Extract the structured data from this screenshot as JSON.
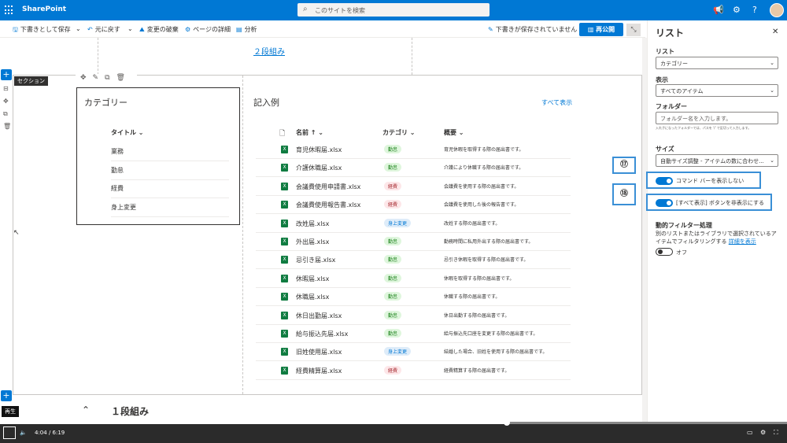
{
  "topbar": {
    "brand": "SharePoint",
    "search_placeholder": "このサイトを検索"
  },
  "cmdbar": {
    "save_draft": "下書きとして保存",
    "undo": "元に戻す",
    "discard": "変更の破棄",
    "page_details": "ページの詳細",
    "analytics": "分析",
    "draft_status": "下書きが保存されていません",
    "publish": "再公開"
  },
  "canvas": {
    "twocol_link": "２段組み",
    "section_tag": "セクション",
    "bottom_title": "１段組み"
  },
  "category_part": {
    "title": "カテゴリー",
    "column": "タイトル",
    "items": [
      "業務",
      "勤怠",
      "経費",
      "身上変更"
    ]
  },
  "example_part": {
    "title": "記入例",
    "see_all": "すべて表示",
    "headers": {
      "name": "名前",
      "category": "カテゴリ",
      "summary": "概要"
    },
    "rows": [
      {
        "name": "育児休暇届.xlsx",
        "cat": "勤怠",
        "color": "green",
        "desc": "育児休暇を取得する際の届出書です。"
      },
      {
        "name": "介護休職届.xlsx",
        "cat": "勤怠",
        "color": "green",
        "desc": "介護により休職する際の届出書です。"
      },
      {
        "name": "会議費使用申請書.xlsx",
        "cat": "経費",
        "color": "red",
        "desc": "会議費を使用する際の届出書です。"
      },
      {
        "name": "会議費使用報告書.xlsx",
        "cat": "経費",
        "color": "red",
        "desc": "会議費を使用した後の報告書です。"
      },
      {
        "name": "改姓届.xlsx",
        "cat": "身上変更",
        "color": "blue",
        "desc": "改姓する際の届出書です。"
      },
      {
        "name": "外出届.xlsx",
        "cat": "勤怠",
        "color": "green",
        "desc": "勤務時間に私用外出する際の届出書です。"
      },
      {
        "name": "忌引き届.xlsx",
        "cat": "勤怠",
        "color": "green",
        "desc": "忌引き休暇を取得する際の届出書です。"
      },
      {
        "name": "休暇届.xlsx",
        "cat": "勤怠",
        "color": "green",
        "desc": "休暇を取得する際の届出書です。"
      },
      {
        "name": "休職届.xlsx",
        "cat": "勤怠",
        "color": "green",
        "desc": "休職する際の届出書です。"
      },
      {
        "name": "休日出勤届.xlsx",
        "cat": "勤怠",
        "color": "green",
        "desc": "休日出勤する際の届出書です。"
      },
      {
        "name": "給与振込先届.xlsx",
        "cat": "勤怠",
        "color": "green",
        "desc": "給与振込先口座を変更する際の届出書です。"
      },
      {
        "name": "旧姓使用届.xlsx",
        "cat": "身上変更",
        "color": "blue",
        "desc": "結婚した場合、旧姓を使用する際の届出書です。"
      },
      {
        "name": "経費精算届.xlsx",
        "cat": "経費",
        "color": "red",
        "desc": "経費精算する際の届出書です。"
      }
    ]
  },
  "panel": {
    "title": "リスト",
    "list_label": "リスト",
    "list_value": "カテゴリー",
    "view_label": "表示",
    "view_value": "すべてのアイテム",
    "folder_label": "フォルダー",
    "folder_placeholder": "フォルダー名を入力します。",
    "folder_hint": "入れ子になったフォルダーでは、パスを '/' で区切って入力します。",
    "size_label": "サイズ",
    "size_value": "自動サイズ調整 - アイテムの数に合わせ...",
    "toggle17_label": "コマンド バーを表示しない",
    "toggle18_label": "[すべて表示] ボタンを非表示にする",
    "badge17": "⑰",
    "badge18": "⑱",
    "dynamic_title": "動的フィルター処理",
    "dynamic_desc": "別のリストまたはライブラリで選択されているアイテムでフィルタリングする",
    "dynamic_link": "詳細を表示",
    "dynamic_state": "オフ"
  },
  "video": {
    "tooltip": "再生",
    "time": "4:04 / 6:19",
    "progress": 0.643
  },
  "colors": {
    "accent": "#0078d4",
    "green_tag": "#dff6dd",
    "red_tag": "#fde7e9",
    "blue_tag": "#deecf9"
  }
}
